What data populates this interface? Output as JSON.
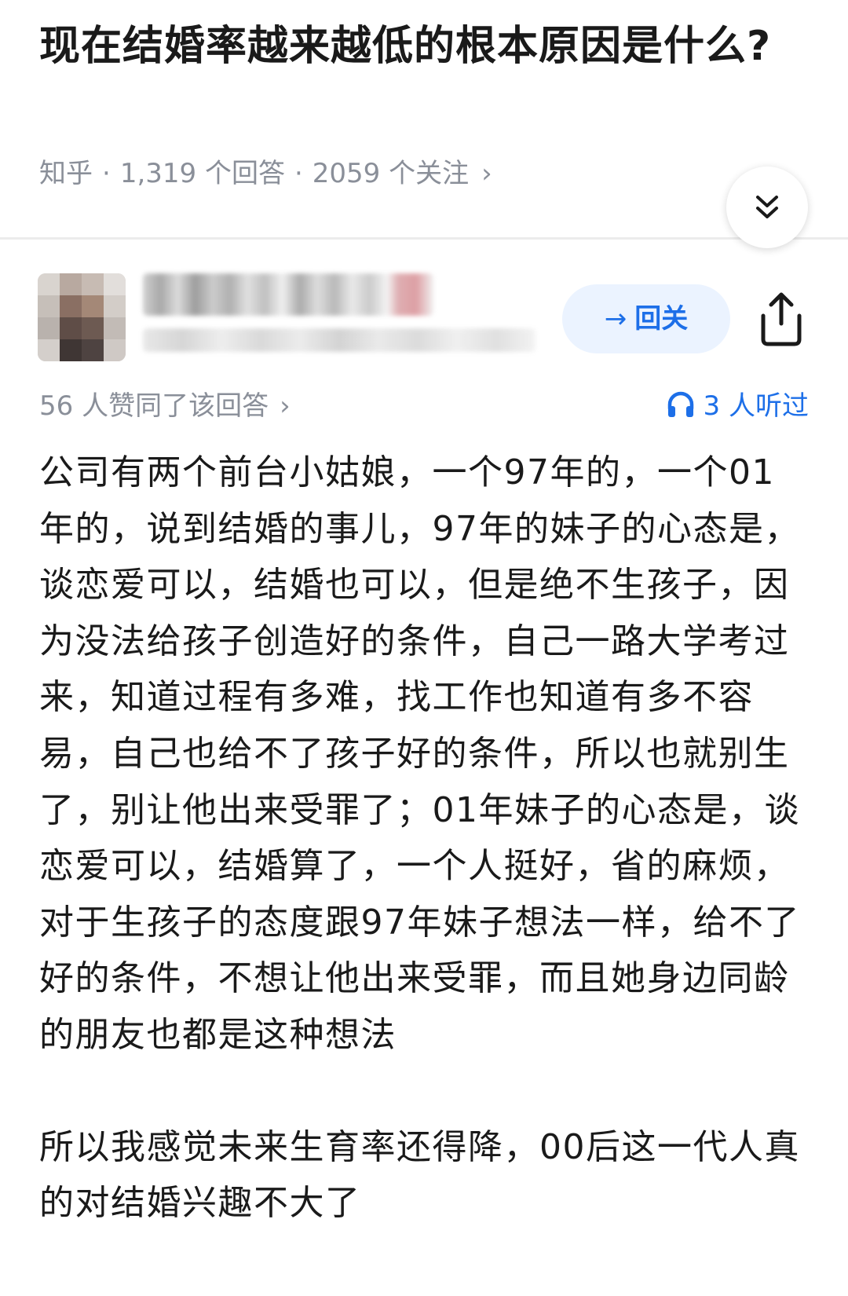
{
  "question": {
    "title": "现在结婚率越来越低的根本原因是什么?",
    "source": "知乎",
    "answer_count": "1,319 个回答",
    "follower_count": "2059 个关注",
    "separator": "·",
    "chevron": "›"
  },
  "author": {
    "follow_button_label": "回关",
    "follow_button_arrow": "→"
  },
  "stats": {
    "upvote_text": "56 人赞同了该回答",
    "upvote_chevron": "›",
    "listen_text": "3 人听过"
  },
  "answer": {
    "paragraphs": [
      "公司有两个前台小姑娘，一个97年的，一个01年的，说到结婚的事儿，97年的妹子的心态是，谈恋爱可以，结婚也可以，但是绝不生孩子，因为没法给孩子创造好的条件，自己一路大学考过来，知道过程有多难，找工作也知道有多不容易，自己也给不了孩子好的条件，所以也就别生了，别让他出来受罪了；01年妹子的心态是，谈恋爱可以，结婚算了，一个人挺好，省的麻烦，对于生孩子的态度跟97年妹子想法一样，给不了好的条件，不想让他出来受罪，而且她身边同龄的朋友也都是这种想法",
      "所以我感觉未来生育率还得降，00后这一代人真的对结婚兴趣不大了"
    ]
  },
  "colors": {
    "text_primary": "#1a1a1a",
    "text_meta": "#8a8f99",
    "accent_blue": "#1d6fe8",
    "follow_button_bg": "#ebf3ff",
    "divider": "#ececec"
  },
  "icons": {
    "collapse": "double-chevron-down-icon",
    "share": "share-icon",
    "listen": "headphones-icon",
    "avatar": "pixelated-avatar"
  }
}
